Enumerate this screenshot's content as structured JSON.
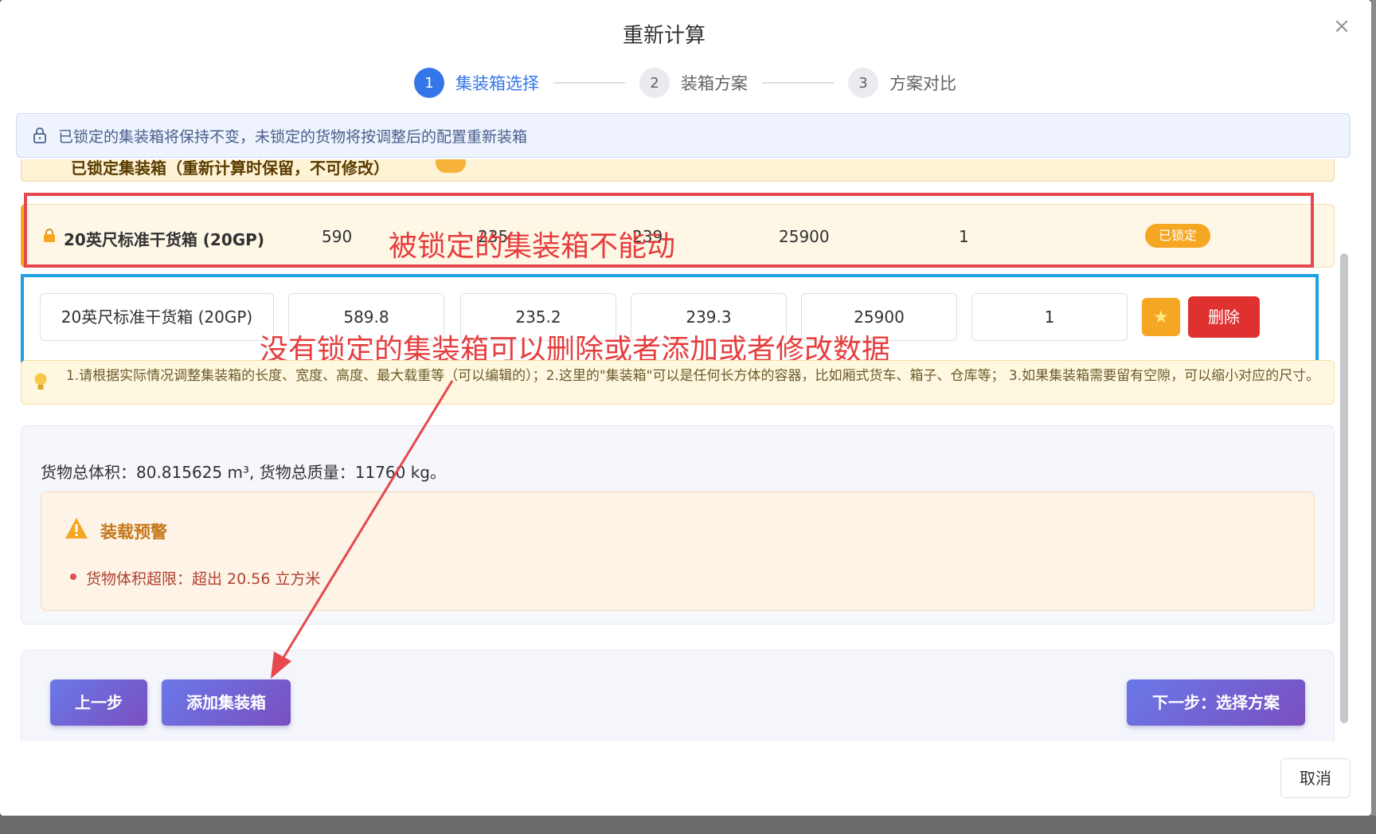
{
  "dialog": {
    "title": "重新计算",
    "close_label": "×",
    "cancel_label": "取消"
  },
  "steps": [
    {
      "num": "1",
      "label": "集装箱选择"
    },
    {
      "num": "2",
      "label": "装箱方案"
    },
    {
      "num": "3",
      "label": "方案对比"
    }
  ],
  "notice": "已锁定的集装箱将保持不变，未锁定的货物将按调整后的配置重新装箱",
  "locked_section": {
    "header": "已锁定集装箱（重新计算时保留，不可修改）",
    "row": {
      "name": "20英尺标准干货箱 (20GP)",
      "length": "590",
      "width": "235",
      "height": "239",
      "max_load": "25900",
      "count": "1",
      "badge": "已锁定"
    }
  },
  "editable_row": {
    "name": "20英尺标准干货箱 (20GP)",
    "length": "589.8",
    "width": "235.2",
    "height": "239.3",
    "max_load": "25900",
    "count": "1",
    "star_icon": "★",
    "delete_label": "删除"
  },
  "annotations": {
    "locked_note": "被锁定的集装箱不能动",
    "unlocked_note": "没有锁定的集装箱可以删除或者添加或者修改数据",
    "red": "#e5484d",
    "blue": "#1ea0e6"
  },
  "tip": "1.请根据实际情况调整集装箱的长度、宽度、高度、最大载重等（可以编辑的）；2.这里的\"集装箱\"可以是任何长方体的容器，比如厢式货车、箱子、仓库等； 3.如果集装箱需要留有空隙，可以缩小对应的尺寸。",
  "summary": {
    "totals": "货物总体积：80.815625 m³, 货物总质量：11760 kg。",
    "warning_title": "装载预警",
    "warning_item": "货物体积超限：超出 20.56 立方米"
  },
  "footer": {
    "prev_label": "上一步",
    "add_label": "添加集装箱",
    "next_label": "下一步：选择方案"
  },
  "colors": {
    "primary": "#3476e8",
    "lock_orange": "#f5a623",
    "danger": "#e03131"
  }
}
